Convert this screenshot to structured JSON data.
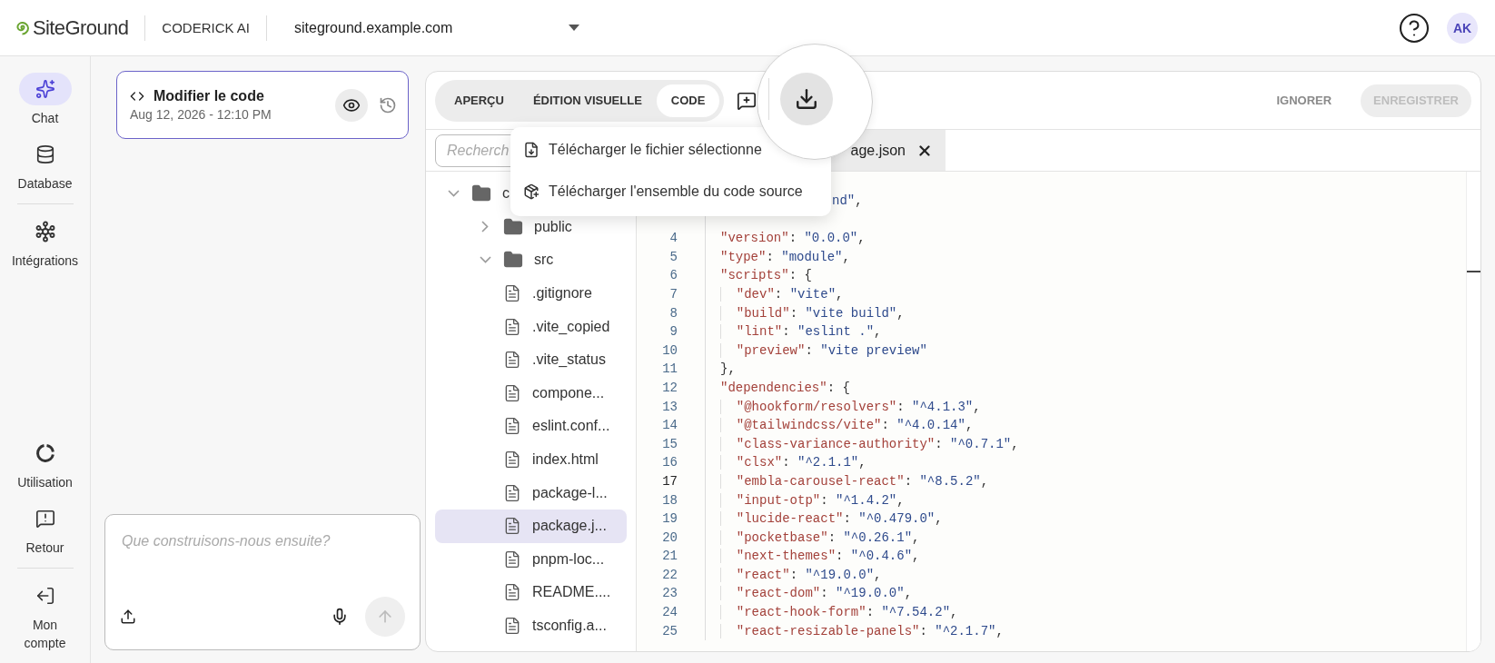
{
  "header": {
    "logo": "SiteGround",
    "product": "CODERICK AI",
    "site": "siteground.example.com",
    "avatar": "AK"
  },
  "nav": {
    "top": [
      {
        "label": "Chat",
        "selected": true
      },
      {
        "label": "Database",
        "selected": false
      },
      {
        "label": "Intégrations",
        "selected": false
      }
    ],
    "bottom": [
      {
        "label": "Utilisation",
        "selected": false
      },
      {
        "label": "Retour",
        "selected": false
      },
      {
        "label": "Mon compte",
        "selected": false
      }
    ]
  },
  "chat": {
    "card": {
      "title": "Modifier le code",
      "date": "Aug 12, 2026 - 12:10 PM"
    },
    "composer": {
      "placeholder": "Que construisons-nous ensuite?"
    }
  },
  "editor": {
    "view_tabs": [
      {
        "label": "APERÇU",
        "selected": false
      },
      {
        "label": "ÉDITION VISUELLE",
        "selected": false
      },
      {
        "label": "CODE",
        "selected": true
      }
    ],
    "actions": [
      {
        "label": "IGNORER",
        "disabled": false
      },
      {
        "label": "ENREGISTRER",
        "disabled": true
      }
    ],
    "search": {
      "placeholder": "Recherch"
    },
    "open_tab": {
      "label": "age.json"
    },
    "tree": [
      {
        "name": "c",
        "kind": "folder",
        "expanded": true,
        "children": [
          {
            "name": "public",
            "kind": "folder",
            "expanded": false
          },
          {
            "name": "src",
            "kind": "folder",
            "expanded": true
          },
          {
            "name": ".gitignore",
            "kind": "file",
            "selected": false
          },
          {
            "name": ".vite_copied",
            "kind": "file",
            "selected": false
          },
          {
            "name": ".vite_status",
            "kind": "file",
            "selected": false
          },
          {
            "name": "compone...",
            "kind": "file",
            "selected": false
          },
          {
            "name": "eslint.conf...",
            "kind": "file",
            "selected": false
          },
          {
            "name": "index.html",
            "kind": "file",
            "selected": false
          },
          {
            "name": "package-l...",
            "kind": "file",
            "selected": false
          },
          {
            "name": "package.j...",
            "kind": "file",
            "selected": true
          },
          {
            "name": "pnpm-loc...",
            "kind": "file",
            "selected": false
          },
          {
            "name": "README....",
            "kind": "file",
            "selected": false
          },
          {
            "name": "tsconfig.a...",
            "kind": "file",
            "selected": false
          }
        ]
      }
    ],
    "code_fragment": "nd\",",
    "code": [
      {
        "number": "4",
        "text": "\"version\": \"0.0.0\",",
        "current": false
      },
      {
        "number": "5",
        "text": "\"type\": \"module\",",
        "current": false
      },
      {
        "number": "6",
        "text": "\"scripts\": {",
        "current": false
      },
      {
        "number": "7",
        "text": "  \"dev\": \"vite\",",
        "current": false
      },
      {
        "number": "8",
        "text": "  \"build\": \"vite build\",",
        "current": false
      },
      {
        "number": "9",
        "text": "  \"lint\": \"eslint .\",",
        "current": false
      },
      {
        "number": "10",
        "text": "  \"preview\": \"vite preview\"",
        "current": false
      },
      {
        "number": "11",
        "text": "},",
        "current": false
      },
      {
        "number": "12",
        "text": "\"dependencies\": {",
        "current": false
      },
      {
        "number": "13",
        "text": "  \"@hookform/resolvers\": \"^4.1.3\",",
        "current": false
      },
      {
        "number": "14",
        "text": "  \"@tailwindcss/vite\": \"^4.0.14\",",
        "current": false
      },
      {
        "number": "15",
        "text": "  \"class-variance-authority\": \"^0.7.1\",",
        "current": false
      },
      {
        "number": "16",
        "text": "  \"clsx\": \"^2.1.1\",",
        "current": false
      },
      {
        "number": "17",
        "text": "  \"embla-carousel-react\": \"^8.5.2\",",
        "current": true
      },
      {
        "number": "18",
        "text": "  \"input-otp\": \"^1.4.2\",",
        "current": false
      },
      {
        "number": "19",
        "text": "  \"lucide-react\": \"^0.479.0\",",
        "current": false
      },
      {
        "number": "20",
        "text": "  \"pocketbase\": \"^0.26.1\",",
        "current": false
      },
      {
        "number": "21",
        "text": "  \"next-themes\": \"^0.4.6\",",
        "current": false
      },
      {
        "number": "22",
        "text": "  \"react\": \"^19.0.0\",",
        "current": false
      },
      {
        "number": "23",
        "text": "  \"react-dom\": \"^19.0.0\",",
        "current": false
      },
      {
        "number": "24",
        "text": "  \"react-hook-form\": \"^7.54.2\",",
        "current": false
      },
      {
        "number": "25",
        "text": "  \"react-resizable-panels\": \"^2.1.7\",",
        "current": false
      }
    ]
  },
  "download_menu": {
    "items": [
      "Télécharger le fichier sélectionne",
      "Télécharger l'ensemble du code source"
    ]
  }
}
